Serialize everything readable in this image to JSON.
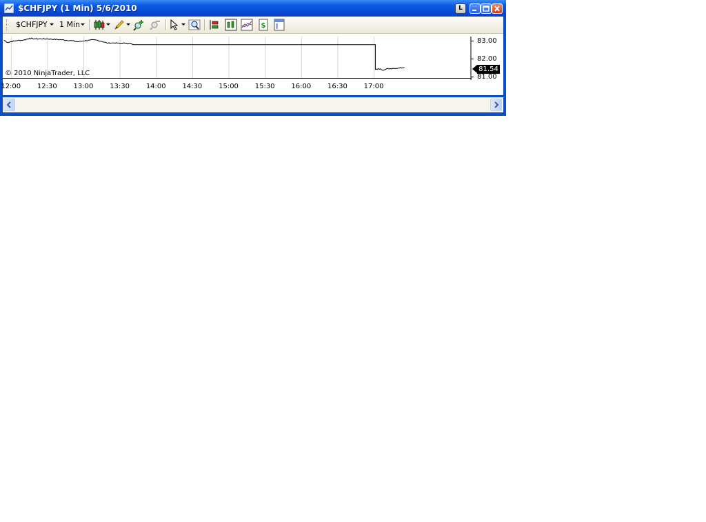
{
  "window": {
    "title": "$CHFJPY (1 Min)  5/6/2010",
    "lock_label": "L"
  },
  "toolbar": {
    "instrument": "$CHFJPY",
    "interval": "1 Min",
    "icons": [
      "chart-style-icon",
      "drawing-tools-icon",
      "zoom-in-icon",
      "zoom-out-icon",
      "select-cursor-icon",
      "magnify-icon",
      "data-box-icon",
      "indicators-icon",
      "strategies-icon",
      "dollar-icon",
      "properties-icon"
    ]
  },
  "chart": {
    "copyright": "© 2010 NinjaTrader, LLC",
    "y_ticks": [
      "83.00",
      "82.00",
      "81.00"
    ],
    "x_ticks": [
      "12:00",
      "12:30",
      "13:00",
      "13:30",
      "14:00",
      "14:30",
      "15:00",
      "15:30",
      "16:00",
      "16:30",
      "17:00"
    ],
    "last_price": "81.54",
    "colors": {
      "price_line": "#000000",
      "grid": "#d4d4d4",
      "label_bg": "#000000",
      "title_bar": "#0a4ec8"
    }
  },
  "chart_data": {
    "type": "line",
    "xlabel": "",
    "ylabel": "",
    "ylim": [
      80.95,
      83.25
    ],
    "xlim": [
      "11:53",
      "18:20"
    ],
    "grid": true,
    "series": [
      {
        "points": [
          [
            "11:54",
            83.05
          ],
          [
            "11:57",
            82.92
          ],
          [
            "12:00",
            82.97
          ],
          [
            "12:05",
            83.03
          ],
          [
            "12:10",
            83.05
          ],
          [
            "12:15",
            83.15
          ],
          [
            "12:20",
            83.12
          ],
          [
            "12:30",
            83.12
          ],
          [
            "12:40",
            83.08
          ],
          [
            "12:50",
            83.02
          ],
          [
            "12:55",
            82.96
          ],
          [
            "13:00",
            83.01
          ],
          [
            "13:05",
            83.05
          ],
          [
            "13:10",
            83.06
          ],
          [
            "13:15",
            82.98
          ],
          [
            "13:20",
            82.88
          ],
          [
            "13:25",
            82.9
          ],
          [
            "13:30",
            82.86
          ],
          [
            "13:35",
            82.88
          ],
          [
            "13:40",
            82.83
          ],
          [
            "13:41",
            82.8
          ],
          [
            "17:01",
            82.8
          ],
          [
            "17:01",
            81.42
          ],
          [
            "17:05",
            81.46
          ],
          [
            "17:08",
            81.38
          ],
          [
            "17:10",
            81.45
          ],
          [
            "17:15",
            81.48
          ],
          [
            "17:20",
            81.5
          ],
          [
            "17:25",
            81.54
          ]
        ]
      }
    ]
  }
}
